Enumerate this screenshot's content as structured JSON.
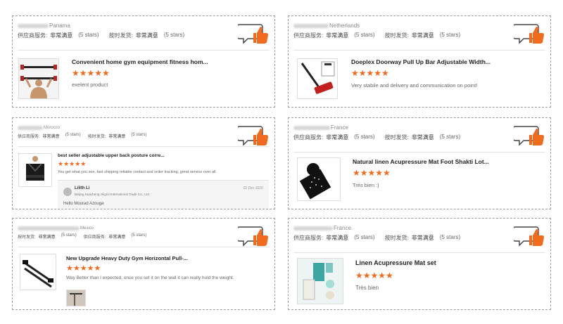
{
  "accent_color": "#f26b1d",
  "cards": [
    {
      "country": "Panama",
      "rating1_label": "供应商服务:",
      "rating1_value": "非常满意",
      "rating1_stars": "(5 stars)",
      "rating2_label": "按时发货:",
      "rating2_value": "非常满意",
      "rating2_stars": "(5 stars)",
      "product_title": "Convenient home gym equipment fitness hom...",
      "stars": "★★★★★",
      "review": "exelent product"
    },
    {
      "country": "Netherlands",
      "rating1_label": "供应商服务:",
      "rating1_value": "非常满意",
      "rating1_stars": "(5 stars)",
      "rating2_label": "按时发货:",
      "rating2_value": "非常满意",
      "rating2_stars": "(5 stars)",
      "product_title": "Doeplex Doorway Pull Up Bar Adjustable Width...",
      "stars": "★★★★★",
      "review": "Very stabile and delivery and communication on point!"
    },
    {
      "country": "Morocco",
      "rating1_label": "供应商服务:",
      "rating1_value": "非常满意",
      "rating1_stars": "(5 stars)",
      "rating2_label": "按时发货:",
      "rating2_value": "非常满意",
      "rating2_stars": "(5 stars)",
      "product_title": "best seller adjustable upper back posture corre...",
      "stars": "★★★★★",
      "review": "You get what you see, fast shipping reliable contact and order tracking, great service over all.",
      "reply": {
        "name": "Lilith Li",
        "company": "Beijing Huacheng Jingrui International Trade Co., Ltd.",
        "date": "02 Dec 2020",
        "text": "Hello  Mourad Azouga"
      }
    },
    {
      "country": "France",
      "rating1_label": "供应商服务:",
      "rating1_value": "非常满意",
      "rating1_stars": "(5 stars)",
      "rating2_label": "按时发货:",
      "rating2_value": "非常满意",
      "rating2_stars": "(5 stars)",
      "product_title": "Natural linen Acupressure Mat Foot Shakti Lot...",
      "stars": "★★★★★",
      "review": "Très bien :)"
    },
    {
      "country": "Mexico",
      "rating1_label": "按时发货:",
      "rating1_value": "非常满意",
      "rating1_stars": "(5 stars)",
      "rating2_label": "供应商服务:",
      "rating2_value": "非常满意",
      "rating2_stars": "(5 stars)",
      "product_title": "New Upgrade Heavy Duty Gym Horizontal Pull-...",
      "stars": "★★★★★",
      "review": "Way Better than I expected, once you set it on the wall it can really hold the weight."
    },
    {
      "country": "France",
      "rating1_label": "供应商服务:",
      "rating1_value": "非常满意",
      "rating1_stars": "(5 stars)",
      "rating2_label": "按时发货:",
      "rating2_value": "非常满意",
      "rating2_stars": "(5 stars)",
      "product_title": "Linen Acupressure Mat set",
      "stars": "★★★★★",
      "review": "Très bien"
    }
  ]
}
